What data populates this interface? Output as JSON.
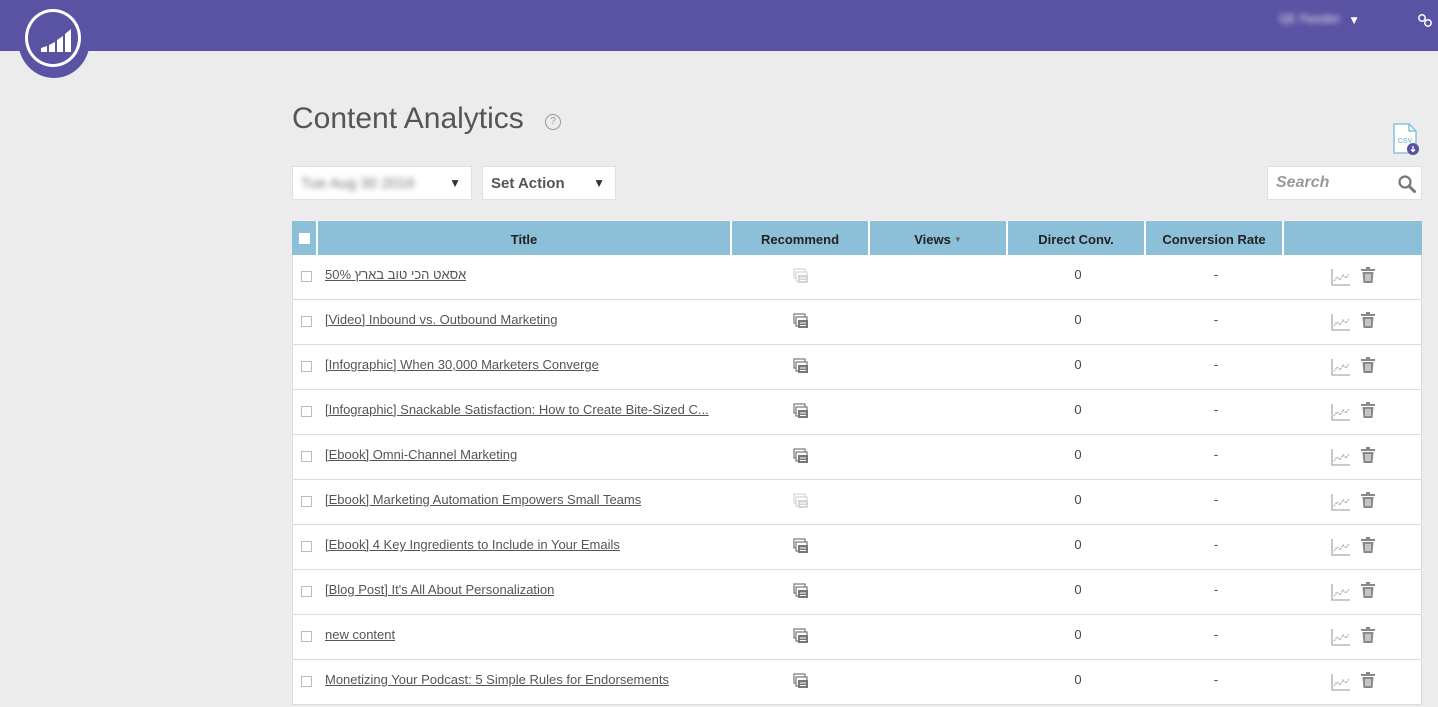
{
  "header": {
    "user_name": "QE Feeder",
    "user_caret": "▼",
    "brand_color": "#5a52a3"
  },
  "page": {
    "title": "Content Analytics",
    "help_icon": "?"
  },
  "filters": {
    "date_value": "Tue Aug 30 2016",
    "action_value": "Set Action",
    "caret": "▼"
  },
  "search": {
    "placeholder": "Search"
  },
  "table": {
    "headers": {
      "title": "Title",
      "recommend": "Recommend",
      "views": "Views",
      "views_sort": "▼",
      "direct_conv": "Direct Conv.",
      "conversion_rate": "Conversion Rate"
    },
    "header_color": "#8cbfd8",
    "rows": [
      {
        "title": "אסאט הכי טוב בארץ 50%",
        "recommend_active": false,
        "direct_conv": "0",
        "conversion_rate": "-"
      },
      {
        "title": "[Video] Inbound vs. Outbound Marketing",
        "recommend_active": true,
        "direct_conv": "0",
        "conversion_rate": "-"
      },
      {
        "title": "[Infographic] When 30,000 Marketers Converge",
        "recommend_active": true,
        "direct_conv": "0",
        "conversion_rate": "-"
      },
      {
        "title": "[Infographic] Snackable Satisfaction: How to Create Bite-Sized C...",
        "recommend_active": true,
        "direct_conv": "0",
        "conversion_rate": "-"
      },
      {
        "title": "[Ebook] Omni-Channel Marketing",
        "recommend_active": true,
        "direct_conv": "0",
        "conversion_rate": "-"
      },
      {
        "title": "[Ebook] Marketing Automation Empowers Small Teams",
        "recommend_active": false,
        "direct_conv": "0",
        "conversion_rate": "-"
      },
      {
        "title": "[Ebook] 4 Key Ingredients to Include in Your Emails",
        "recommend_active": true,
        "direct_conv": "0",
        "conversion_rate": "-"
      },
      {
        "title": "[Blog Post] It's All About Personalization",
        "recommend_active": true,
        "direct_conv": "0",
        "conversion_rate": "-"
      },
      {
        "title": "new content",
        "recommend_active": true,
        "direct_conv": "0",
        "conversion_rate": "-"
      },
      {
        "title": "Monetizing Your Podcast: 5 Simple Rules for Endorsements",
        "recommend_active": true,
        "direct_conv": "0",
        "conversion_rate": "-"
      }
    ]
  }
}
